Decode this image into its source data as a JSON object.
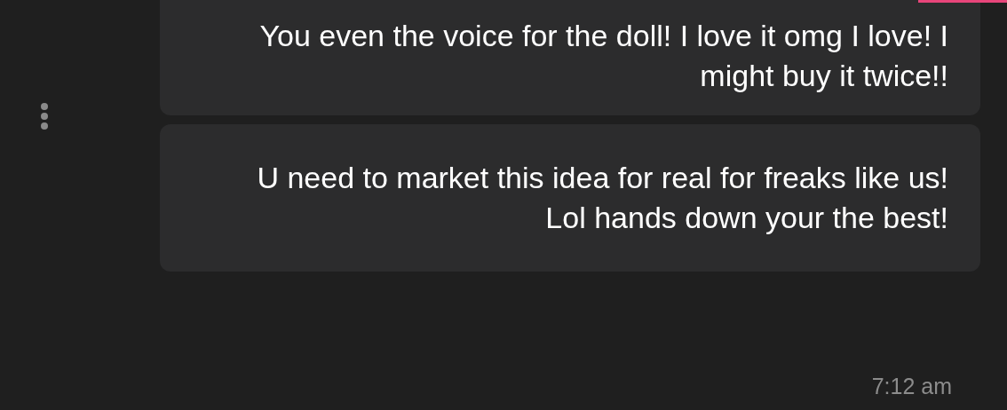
{
  "messages": [
    {
      "text": "You even the voice for the doll! I love it omg I love! I might buy it twice!!"
    },
    {
      "text": "U need to market this idea for real for freaks like us! Lol hands down your the best!"
    }
  ],
  "timestamp": "7:12 am"
}
